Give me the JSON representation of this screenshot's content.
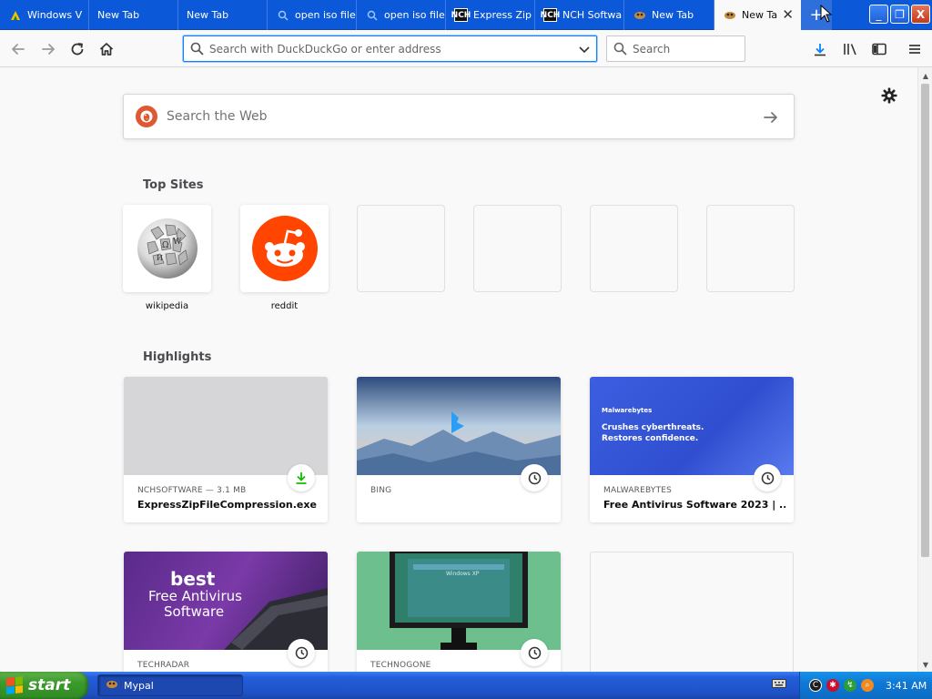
{
  "tabs": [
    {
      "label": "Windows V",
      "icon": "windows-icon"
    },
    {
      "label": "New Tab",
      "icon": ""
    },
    {
      "label": "New Tab",
      "icon": ""
    },
    {
      "label": "open iso file",
      "icon": "search-icon"
    },
    {
      "label": "open iso file",
      "icon": "search-icon"
    },
    {
      "label": "Express Zip",
      "icon": "nch-icon"
    },
    {
      "label": "NCH Softwa",
      "icon": "nch-icon"
    },
    {
      "label": "New Tab",
      "icon": "mypal-icon"
    },
    {
      "label": "New Tab",
      "icon": "mypal-icon",
      "active": true
    }
  ],
  "newtab_symbol": "+",
  "window_controls": {
    "minimize": "_",
    "restore": "❐",
    "close": "X"
  },
  "nav": {
    "url_placeholder": "Search with DuckDuckGo or enter address",
    "search_placeholder": "Search"
  },
  "web_search": {
    "placeholder": "Search the Web"
  },
  "top_sites": {
    "title": "Top Sites",
    "items": [
      {
        "label": "wikipedia",
        "icon": "wikipedia-logo"
      },
      {
        "label": "reddit",
        "icon": "reddit-logo"
      },
      {
        "label": "",
        "empty": true
      },
      {
        "label": "",
        "empty": true
      },
      {
        "label": "",
        "empty": true
      },
      {
        "label": "",
        "empty": true
      }
    ]
  },
  "highlights": {
    "title": "Highlights",
    "cards": [
      {
        "source": "NCHSOFTWARE — 3.1 MB",
        "title": "ExpressZipFileCompression.exe",
        "badge": "download-icon"
      },
      {
        "source": "BING",
        "title": "",
        "badge": "clock-icon"
      },
      {
        "source": "MALWAREBYTES",
        "title": "Free Antivirus Software 2023 | ...",
        "badge": "clock-icon",
        "image_text": [
          "Malwarebytes",
          "Crushes cyberthreats.",
          "Restores confidence."
        ]
      },
      {
        "source": "TECHRADAR",
        "title": "",
        "badge": "clock-icon",
        "image_text": [
          "best",
          "Free Antivirus",
          "Software"
        ]
      },
      {
        "source": "TECHNOGONE",
        "title": "",
        "badge": "clock-icon"
      },
      {
        "source": "",
        "title": "",
        "empty": true
      }
    ]
  },
  "taskbar": {
    "start_label": "start",
    "task_label": "Mypal",
    "clock": "3:41 AM"
  },
  "colors": {
    "titlebar": "#0b58d8",
    "accent": "#0a84ff",
    "ddg": "#de5833",
    "reddit": "#ff4500",
    "start_green": "#3c9a2d",
    "download_green": "#12bc00"
  }
}
